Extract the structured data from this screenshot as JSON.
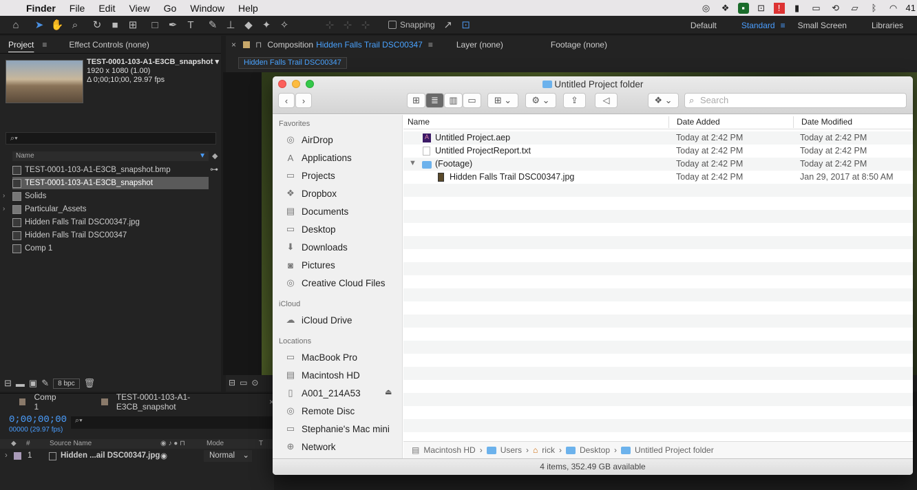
{
  "menubar": {
    "app": "Finder",
    "items": [
      "File",
      "Edit",
      "View",
      "Go",
      "Window",
      "Help"
    ],
    "battery": "41"
  },
  "ae": {
    "snapping_label": "Snapping",
    "workspaces": [
      "Default",
      "Standard",
      "Small Screen",
      "Libraries"
    ],
    "active_workspace": "Standard"
  },
  "project": {
    "tab_project": "Project",
    "tab_effects": "Effect Controls (none)",
    "thumb_name": "TEST-0001-103-A1-E3CB_snapshot",
    "thumb_res": "1920 x 1080 (1.00)",
    "thumb_dur": "Δ 0;00;10;00, 29.97 fps",
    "search_glyph": "⌕▾",
    "col_name": "Name",
    "items": [
      {
        "label": "TEST-0001-103-A1-E3CB_snapshot.bmp",
        "type": "file"
      },
      {
        "label": "TEST-0001-103-A1-E3CB_snapshot",
        "type": "comp"
      },
      {
        "label": "Solids",
        "type": "folder"
      },
      {
        "label": "Particular_Assets",
        "type": "folder"
      },
      {
        "label": "Hidden Falls Trail DSC00347.jpg",
        "type": "file"
      },
      {
        "label": "Hidden Falls Trail DSC00347",
        "type": "comp"
      },
      {
        "label": "Comp 1",
        "type": "comp"
      }
    ],
    "bpc": "8 bpc"
  },
  "comp": {
    "tab_prefix": "Composition",
    "tab_name": "Hidden Falls Trail DSC00347",
    "layer_tab": "Layer (none)",
    "footage_tab": "Footage (none)",
    "comp_tag": "Hidden Falls Trail DSC00347"
  },
  "timeline": {
    "tab1": "Comp 1",
    "tab2": "TEST-0001-103-A1-E3CB_snapshot",
    "timecode": "0;00;00;00",
    "fps": "00000 (29.97 fps)",
    "col_num": "#",
    "col_source": "Source Name",
    "col_mode": "Mode",
    "col_t": "T",
    "layer_num": "1",
    "layer_name": "Hidden ...ail DSC00347.jpg",
    "layer_mode": "Normal"
  },
  "finder": {
    "title": "Untitled Project folder",
    "search_placeholder": "Search",
    "favorites_header": "Favorites",
    "favorites": [
      "AirDrop",
      "Applications",
      "Projects",
      "Dropbox",
      "Documents",
      "Desktop",
      "Downloads",
      "Pictures",
      "Creative Cloud Files"
    ],
    "icloud_header": "iCloud",
    "icloud": [
      "iCloud Drive"
    ],
    "locations_header": "Locations",
    "locations": [
      "MacBook Pro",
      "Macintosh HD",
      "A001_214A53",
      "Remote Disc",
      "Stephanie's Mac mini",
      "Network"
    ],
    "columns": {
      "name": "Name",
      "added": "Date Added",
      "modified": "Date Modified"
    },
    "files": [
      {
        "name": "Untitled Project.aep",
        "added": "Today at 2:42 PM",
        "modified": "Today at 2:42 PM"
      },
      {
        "name": "Untitled ProjectReport.txt",
        "added": "Today at 2:42 PM",
        "modified": "Today at 2:42 PM"
      },
      {
        "name": "(Footage)",
        "added": "Today at 2:42 PM",
        "modified": "Today at 2:42 PM"
      },
      {
        "name": "Hidden Falls Trail DSC00347.jpg",
        "added": "Today at 2:42 PM",
        "modified": "Jan 29, 2017 at 8:50 AM"
      }
    ],
    "path": [
      "Macintosh HD",
      "Users",
      "rick",
      "Desktop",
      "Untitled Project folder"
    ],
    "status": "4 items, 352.49 GB available"
  }
}
